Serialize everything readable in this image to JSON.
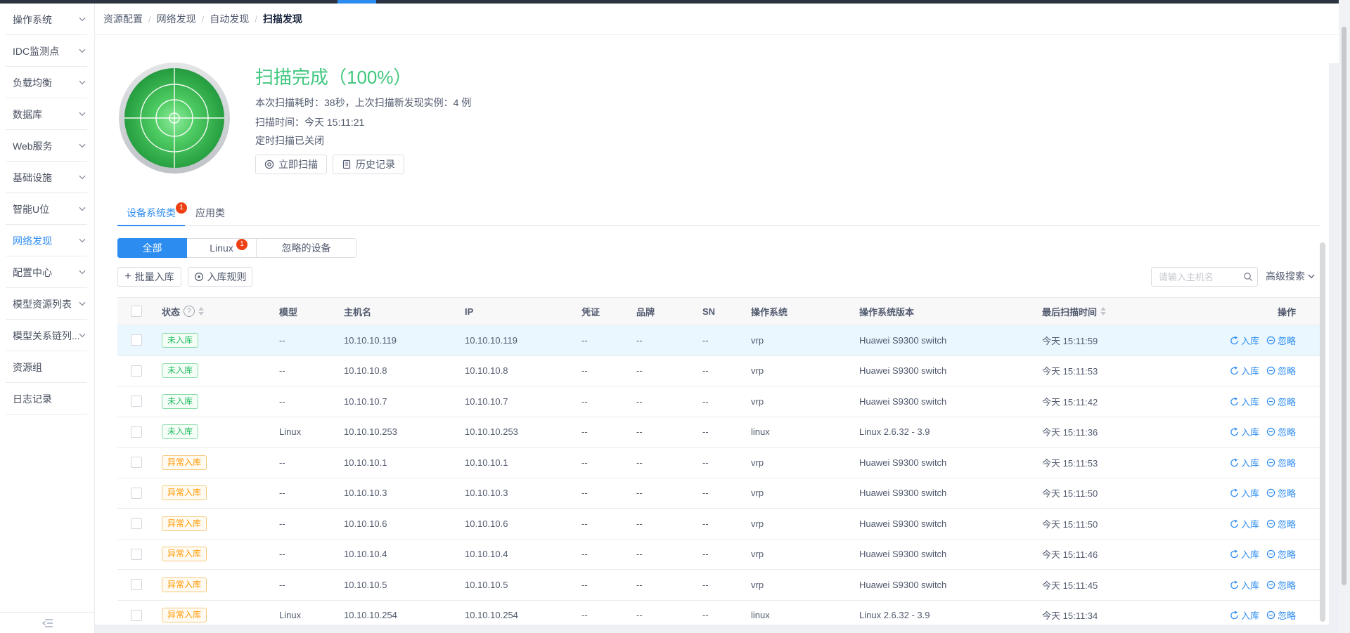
{
  "breadcrumb": {
    "items": [
      "资源配置",
      "网络发现",
      "自动发现",
      "扫描发现"
    ]
  },
  "sidebar": {
    "items": [
      {
        "label": "操作系统",
        "chevron": true,
        "active": false
      },
      {
        "label": "IDC监测点",
        "chevron": true,
        "active": false
      },
      {
        "label": "负载均衡",
        "chevron": true,
        "active": false
      },
      {
        "label": "数据库",
        "chevron": true,
        "active": false
      },
      {
        "label": "Web服务",
        "chevron": true,
        "active": false
      },
      {
        "label": "基础设施",
        "chevron": true,
        "active": false
      },
      {
        "label": "智能U位",
        "chevron": true,
        "active": false
      },
      {
        "label": "网络发现",
        "chevron": true,
        "active": true
      },
      {
        "label": "配置中心",
        "chevron": true,
        "active": false
      },
      {
        "label": "模型资源列表",
        "chevron": true,
        "active": false
      },
      {
        "label": "模型关系链列...",
        "chevron": true,
        "active": false
      },
      {
        "label": "资源组",
        "chevron": false,
        "active": false
      },
      {
        "label": "日志记录",
        "chevron": false,
        "active": false
      }
    ]
  },
  "scan": {
    "title": "扫描完成（100%）",
    "line1": "本次扫描耗时：38秒，上次扫描新发现实例：4 例",
    "line2": "扫描时间：今天 15:11:21",
    "line3": "定时扫描已关闭",
    "scan_now_label": "立即扫描",
    "history_label": "历史记录"
  },
  "tabs": {
    "device_label": "设备系统类",
    "device_badge": "1",
    "app_label": "应用类"
  },
  "subtabs": {
    "all_label": "全部",
    "linux_label": "Linux",
    "linux_badge": "1",
    "ignored_label": "忽略的设备"
  },
  "toolbar": {
    "batch_label": "批量入库",
    "rule_label": "入库规则",
    "search_placeholder": "请输入主机名",
    "advanced_label": "高级搜索"
  },
  "table": {
    "headers": {
      "status": "状态",
      "model": "模型",
      "host": "主机名",
      "ip": "IP",
      "credential": "凭证",
      "brand": "品牌",
      "sn": "SN",
      "os": "操作系统",
      "os_version": "操作系统版本",
      "last_scan": "最后扫描时间",
      "action": "操作"
    },
    "action_in_label": "入库",
    "action_ignore_label": "忽略",
    "rows": [
      {
        "status": "未入库",
        "status_type": "green",
        "model": "--",
        "host": "10.10.10.119",
        "ip": "10.10.10.119",
        "credential": "--",
        "brand": "--",
        "sn": "--",
        "os": "vrp",
        "os_version": "Huawei S9300 switch",
        "last_scan": "今天 15:11:59",
        "highlight": true
      },
      {
        "status": "未入库",
        "status_type": "green",
        "model": "--",
        "host": "10.10.10.8",
        "ip": "10.10.10.8",
        "credential": "--",
        "brand": "--",
        "sn": "--",
        "os": "vrp",
        "os_version": "Huawei S9300 switch",
        "last_scan": "今天 15:11:53",
        "highlight": false
      },
      {
        "status": "未入库",
        "status_type": "green",
        "model": "--",
        "host": "10.10.10.7",
        "ip": "10.10.10.7",
        "credential": "--",
        "brand": "--",
        "sn": "--",
        "os": "vrp",
        "os_version": "Huawei S9300 switch",
        "last_scan": "今天 15:11:42",
        "highlight": false
      },
      {
        "status": "未入库",
        "status_type": "green",
        "model": "Linux",
        "host": "10.10.10.253",
        "ip": "10.10.10.253",
        "credential": "--",
        "brand": "--",
        "sn": "--",
        "os": "linux",
        "os_version": "Linux 2.6.32 - 3.9",
        "last_scan": "今天 15:11:36",
        "highlight": false
      },
      {
        "status": "异常入库",
        "status_type": "orange",
        "model": "--",
        "host": "10.10.10.1",
        "ip": "10.10.10.1",
        "credential": "--",
        "brand": "--",
        "sn": "--",
        "os": "vrp",
        "os_version": "Huawei S9300 switch",
        "last_scan": "今天 15:11:53",
        "highlight": false
      },
      {
        "status": "异常入库",
        "status_type": "orange",
        "model": "--",
        "host": "10.10.10.3",
        "ip": "10.10.10.3",
        "credential": "--",
        "brand": "--",
        "sn": "--",
        "os": "vrp",
        "os_version": "Huawei S9300 switch",
        "last_scan": "今天 15:11:50",
        "highlight": false
      },
      {
        "status": "异常入库",
        "status_type": "orange",
        "model": "--",
        "host": "10.10.10.6",
        "ip": "10.10.10.6",
        "credential": "--",
        "brand": "--",
        "sn": "--",
        "os": "vrp",
        "os_version": "Huawei S9300 switch",
        "last_scan": "今天 15:11:50",
        "highlight": false
      },
      {
        "status": "异常入库",
        "status_type": "orange",
        "model": "--",
        "host": "10.10.10.4",
        "ip": "10.10.10.4",
        "credential": "--",
        "brand": "--",
        "sn": "--",
        "os": "vrp",
        "os_version": "Huawei S9300 switch",
        "last_scan": "今天 15:11:46",
        "highlight": false
      },
      {
        "status": "异常入库",
        "status_type": "orange",
        "model": "--",
        "host": "10.10.10.5",
        "ip": "10.10.10.5",
        "credential": "--",
        "brand": "--",
        "sn": "--",
        "os": "vrp",
        "os_version": "Huawei S9300 switch",
        "last_scan": "今天 15:11:45",
        "highlight": false
      },
      {
        "status": "异常入库",
        "status_type": "orange",
        "model": "Linux",
        "host": "10.10.10.254",
        "ip": "10.10.10.254",
        "credential": "--",
        "brand": "--",
        "sn": "--",
        "os": "linux",
        "os_version": "Linux 2.6.32 - 3.9",
        "last_scan": "今天 15:11:34",
        "highlight": false
      }
    ]
  },
  "colors": {
    "primary": "#2d8cf0",
    "success": "#40c77e",
    "warning": "#ff9900",
    "danger": "#ed4014"
  }
}
